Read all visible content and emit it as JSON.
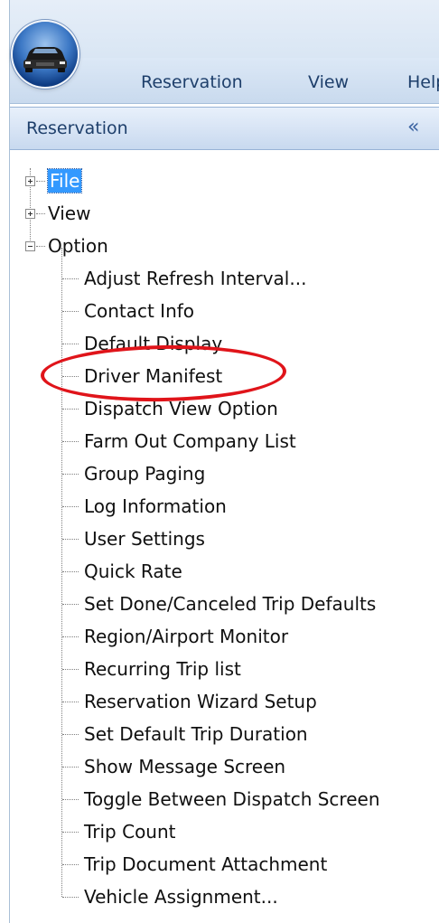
{
  "menubar": {
    "items": [
      "Reservation",
      "View",
      "Help"
    ]
  },
  "panel": {
    "title": "Reservation",
    "collapse_glyph": "«"
  },
  "tree": {
    "roots": [
      {
        "label": "File",
        "state": "collapsed",
        "selected": true
      },
      {
        "label": "View",
        "state": "collapsed",
        "selected": false
      },
      {
        "label": "Option",
        "state": "expanded",
        "selected": false
      }
    ],
    "option_children": [
      "Adjust Refresh Interval...",
      "Contact Info",
      "Default Display",
      "Driver Manifest",
      "Dispatch View Option",
      "Farm Out Company List",
      "Group Paging",
      "Log Information",
      "User Settings",
      "Quick Rate",
      "Set Done/Canceled Trip Defaults",
      "Region/Airport Monitor",
      "Recurring Trip list",
      "Reservation Wizard Setup",
      "Set Default Trip Duration",
      "Show Message Screen",
      "Toggle Between Dispatch Screen",
      "Trip Count",
      "Trip Document Attachment",
      "Vehicle Assignment..."
    ],
    "highlighted_item": "Driver Manifest"
  },
  "colors": {
    "highlight_ellipse": "#e0141a",
    "selection": "#3399ff",
    "menu_text": "#1e3f6b"
  },
  "icons": {
    "app_orb": "car-logo-icon",
    "collapse": "double-chevron-left-icon"
  }
}
